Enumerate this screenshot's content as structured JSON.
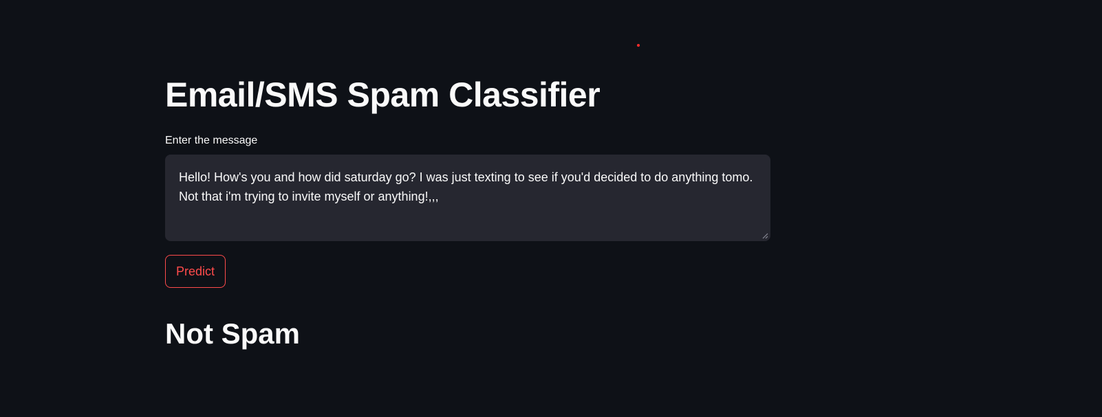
{
  "app": {
    "title": "Email/SMS Spam Classifier"
  },
  "form": {
    "message_label": "Enter the message",
    "message_value": "Hello! How's you and how did saturday go? I was just texting to see if you'd decided to do anything tomo. Not that i'm trying to invite myself or anything!,,,",
    "predict_label": "Predict"
  },
  "result": {
    "label": "Not Spam"
  },
  "colors": {
    "background": "#0e1117",
    "input_background": "#262730",
    "accent": "#ff4b4b",
    "text": "#fafafa"
  }
}
